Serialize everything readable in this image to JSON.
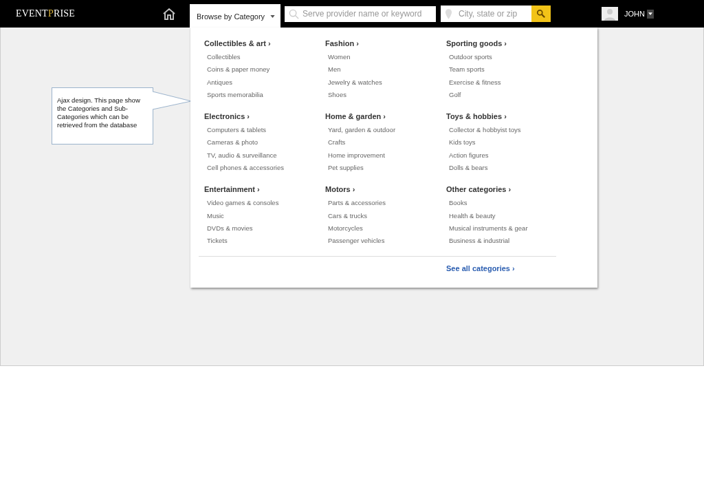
{
  "header": {
    "logo_parts": [
      {
        "text": "EVENT",
        "accent": false
      },
      {
        "text": "P",
        "accent": true
      },
      {
        "text": "RISE",
        "accent": false
      }
    ],
    "browse_tab": {
      "label": "Browse by Category",
      "expanded": true
    },
    "search": {
      "placeholder": "Serve provider name or keyword"
    },
    "location": {
      "placeholder": "City, state or zip"
    },
    "user": {
      "name": "JOHN"
    }
  },
  "categories": [
    {
      "title": "Collectibles & art ›",
      "items": [
        "Collectibles",
        "Coins & paper money",
        "Antiques",
        "Sports memorabilia"
      ]
    },
    {
      "title": "Fashion ›",
      "items": [
        "Women",
        "Men",
        "Jewelry & watches",
        "Shoes"
      ]
    },
    {
      "title": "Sporting goods ›",
      "items": [
        "Outdoor sports",
        "Team sports",
        "Exercise & fitness",
        "Golf"
      ]
    },
    {
      "title": "Electronics ›",
      "items": [
        "Computers & tablets",
        "Cameras & photo",
        "TV, audio & surveillance",
        "Cell phones & accessories"
      ]
    },
    {
      "title": "Home & garden ›",
      "items": [
        "Yard, garden & outdoor",
        "Crafts",
        "Home improvement",
        "Pet supplies"
      ]
    },
    {
      "title": "Toys & hobbies ›",
      "items": [
        "Collector & hobbyist toys",
        "Kids toys",
        "Action figures",
        "Dolls & bears"
      ]
    },
    {
      "title": "Entertainment ›",
      "items": [
        "Video games & consoles",
        "Music",
        "DVDs & movies",
        "Tickets"
      ]
    },
    {
      "title": "Motors ›",
      "items": [
        "Parts & accessories",
        "Cars & trucks",
        "Motorcycles",
        "Passenger vehicles"
      ]
    },
    {
      "title": "Other categories ›",
      "items": [
        "Books",
        "Health & beauty",
        "Musical instruments & gear",
        "Business & industrial"
      ]
    }
  ],
  "see_all": "See all categories ›",
  "note": "Ajax design. This page show the Categories and Sub-Categories which can be retrieved from the database"
}
